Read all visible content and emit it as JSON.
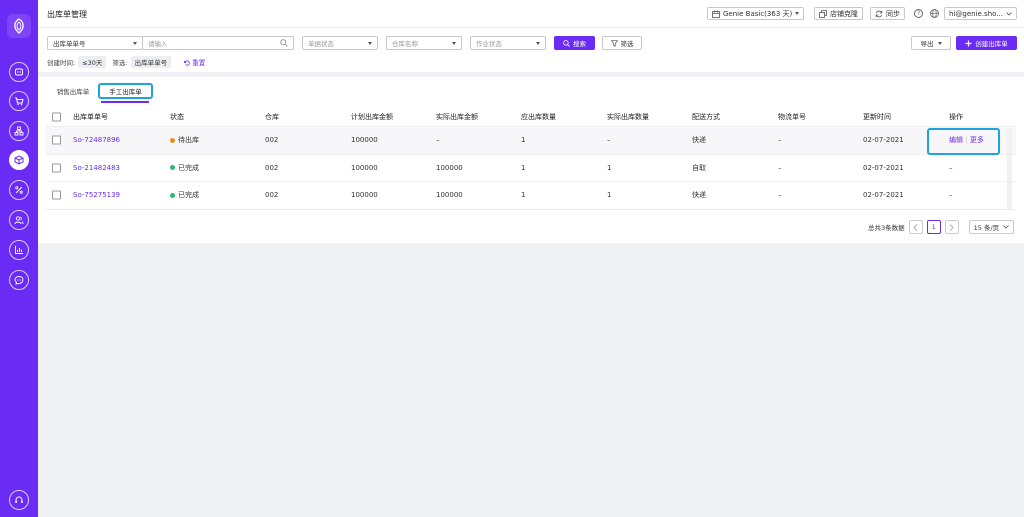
{
  "header": {
    "title": "出库单管理",
    "plan_label": "Genie Basic(363 天)",
    "clone_label": "店铺克隆",
    "sync_label": "同步",
    "user_label": "hi@genie.sho..."
  },
  "filters": {
    "field_select": "出库单单号",
    "search_placeholder": "请输入",
    "status_placeholder": "单据状态",
    "warehouse_placeholder": "仓库名称",
    "task_placeholder": "作业状态",
    "search_label": "搜索",
    "filter_label": "筛选",
    "export_label": "导出",
    "create_label": "创建出库单"
  },
  "conditions": {
    "created_label": "创建时间:",
    "created_value": "≤30天",
    "filter_label": "筛选:",
    "filter_value": "出库单单号",
    "reset_label": "重置"
  },
  "tabs": [
    {
      "label": "销售出库单"
    },
    {
      "label": "手工出库单"
    }
  ],
  "table": {
    "columns": [
      "出库单单号",
      "状态",
      "仓库",
      "计划出库金额",
      "实际出库金额",
      "应出库数量",
      "实际出库数量",
      "配送方式",
      "物流单号",
      "更新时间",
      "操作"
    ],
    "rows": [
      {
        "id": "So-72487896",
        "status": "待出库",
        "warehouse": "002",
        "planned_amount": "100000",
        "actual_amount": "–",
        "should_qty": "1",
        "actual_qty": "–",
        "delivery": "快递",
        "tracking": "–",
        "updated": "02-07-2021",
        "edit": "编辑",
        "more": "更多"
      },
      {
        "id": "So-21482483",
        "status": "已完成",
        "warehouse": "002",
        "planned_amount": "100000",
        "actual_amount": "100000",
        "should_qty": "1",
        "actual_qty": "1",
        "delivery": "自取",
        "tracking": "–",
        "updated": "02-07-2021",
        "ops": "–"
      },
      {
        "id": "So-75275139",
        "status": "已完成",
        "warehouse": "002",
        "planned_amount": "100000",
        "actual_amount": "100000",
        "should_qty": "1",
        "actual_qty": "1",
        "delivery": "快递",
        "tracking": "–",
        "updated": "02-07-2021",
        "ops": "–"
      }
    ]
  },
  "pagination": {
    "total_label": "总共3条数据",
    "current_page": "1",
    "page_size": "15 条/页"
  },
  "colors": {
    "accent": "#6a2cf5",
    "pending": "#f08a24",
    "done": "#2eb872",
    "highlight": "#1ea3de"
  }
}
